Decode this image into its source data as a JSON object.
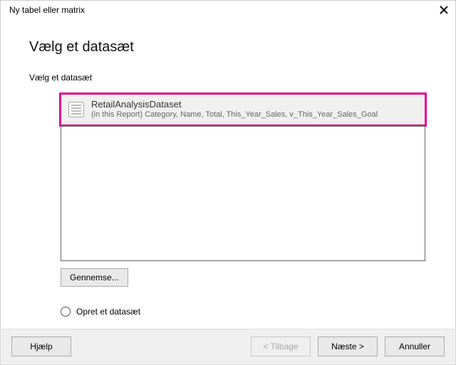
{
  "window": {
    "title": "Ny tabel eller matrix"
  },
  "page": {
    "heading": "Vælg et datasæt",
    "section_label": "Vælg et datasæt"
  },
  "dataset": {
    "name": "RetailAnalysisDataset",
    "description": "(in this Report) Category, Name, Total, This_Year_Sales, v_This_Year_Sales_Goal"
  },
  "buttons": {
    "browse": "Gennemse...",
    "help": "Hjælp",
    "back": "< Tilbage",
    "next": "Næste >",
    "cancel": "Annuller"
  },
  "radio": {
    "create_label": "Opret et datasæt"
  }
}
